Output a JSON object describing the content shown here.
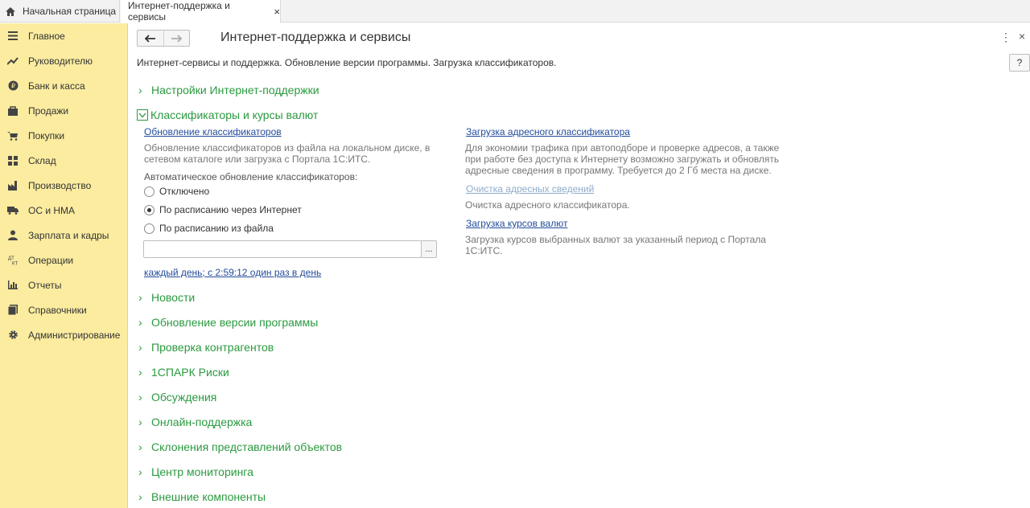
{
  "tabs": {
    "home_label": "Начальная страница",
    "active_label": "Интернет-поддержка и сервисы",
    "close_glyph": "×"
  },
  "sidebar": {
    "items": [
      {
        "label": "Главное",
        "icon": "menu-icon"
      },
      {
        "label": "Руководителю",
        "icon": "trend-icon"
      },
      {
        "label": "Банк и касса",
        "icon": "ruble-icon"
      },
      {
        "label": "Продажи",
        "icon": "bag-icon"
      },
      {
        "label": "Покупки",
        "icon": "cart-icon"
      },
      {
        "label": "Склад",
        "icon": "warehouse-icon"
      },
      {
        "label": "Производство",
        "icon": "factory-icon"
      },
      {
        "label": "ОС и НМА",
        "icon": "truck-icon"
      },
      {
        "label": "Зарплата и кадры",
        "icon": "person-icon"
      },
      {
        "label": "Операции",
        "icon": "dt-kt-icon"
      },
      {
        "label": "Отчеты",
        "icon": "bar-chart-icon"
      },
      {
        "label": "Справочники",
        "icon": "books-icon"
      },
      {
        "label": "Администрирование",
        "icon": "gear-icon"
      }
    ]
  },
  "header": {
    "title": "Интернет-поддержка и сервисы",
    "description": "Интернет-сервисы и поддержка. Обновление версии программы. Загрузка классификаторов.",
    "help_label": "?",
    "more_glyph": "⋮",
    "close_glyph": "×"
  },
  "sections": {
    "settings": "Настройки Интернет-поддержки",
    "classifiers": "Классификаторы и курсы валют",
    "collapsed": [
      "Новости",
      "Обновление версии программы",
      "Проверка контрагентов",
      "1СПАРК Риски",
      "Обсуждения",
      "Онлайн-поддержка",
      "Склонения представлений объектов",
      "Центр мониторинга",
      "Внешние компоненты"
    ]
  },
  "classifiers": {
    "update_link": "Обновление классификаторов",
    "update_note_1": "Обновление классификаторов из файла на локальном диске, в",
    "update_note_2": "сетевом каталоге или загрузка с Портала 1С:ИТС.",
    "auto_label": "Автоматическое обновление классификаторов:",
    "radio_off": "Отключено",
    "radio_internet": "По расписанию через Интернет",
    "radio_file": "По расписанию из файла",
    "selected": "internet",
    "file_value": "",
    "file_button": "...",
    "schedule_link": "каждый день; с 2:59:12 один раз в день",
    "address_link": "Загрузка адресного классификатора",
    "address_note_1": "Для экономии трафика при автоподборе и проверке адресов, а также",
    "address_note_2": "при работе без доступа к Интернету возможно загружать и обновлять",
    "address_note_3": "адресные сведения в программу. Требуется до 2 Гб места на диске.",
    "clear_link": "Очистка адресных сведений",
    "clear_note": "Очистка адресного классификатора.",
    "rates_link": "Загрузка курсов валют",
    "rates_note_1": "Загрузка курсов выбранных валют за указанный период с Портала",
    "rates_note_2": "1С:ИТС."
  },
  "colors": {
    "sidebar_bg": "#fbeca0",
    "section_green": "#2a9a3f",
    "link_blue": "#234c9c"
  }
}
